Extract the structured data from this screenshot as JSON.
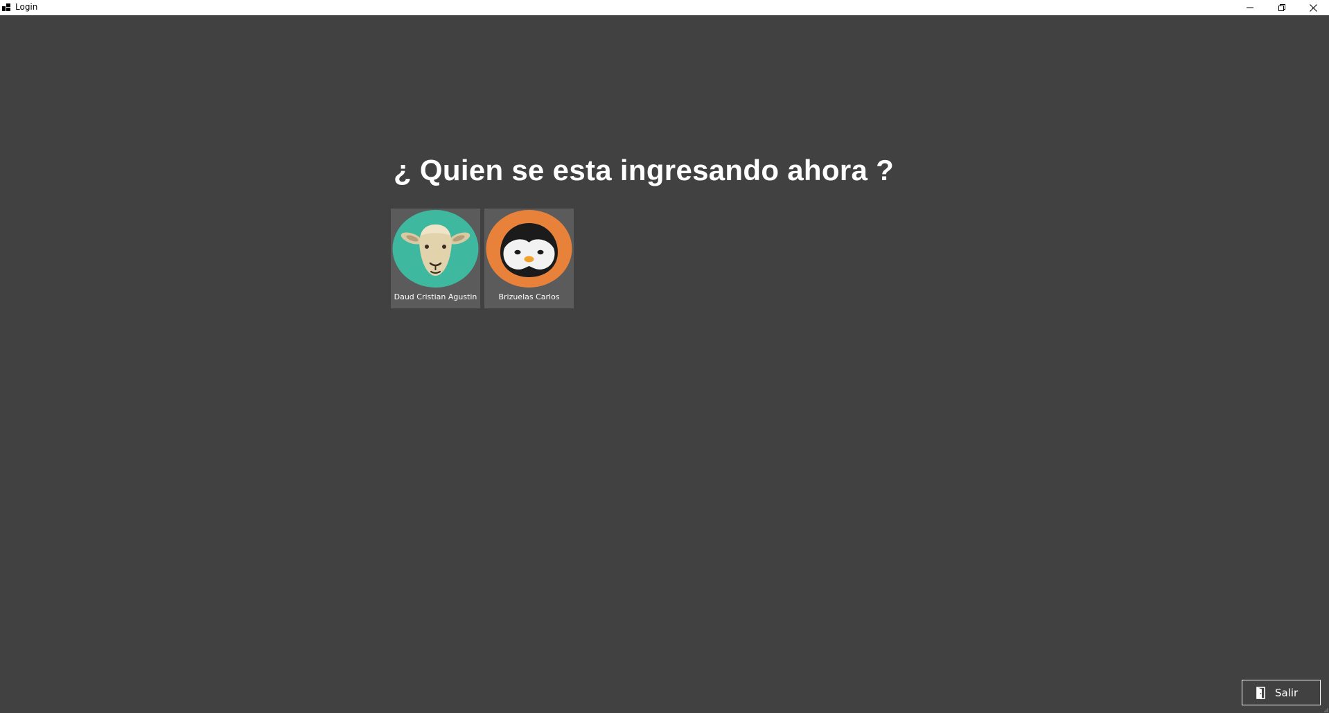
{
  "window": {
    "title": "Login",
    "icon": "app-window-icon",
    "controls": [
      "minimize-icon",
      "restore-icon",
      "close-icon"
    ]
  },
  "main": {
    "heading": "¿ Quien se esta ingresando ahora ?",
    "users": [
      {
        "name": "Daud Cristian Agustin",
        "avatar": "sheep-avatar",
        "avatar_color": "#3fb8a0"
      },
      {
        "name": "Brizuelas Carlos",
        "avatar": "penguin-avatar",
        "avatar_color": "#e8823a"
      }
    ]
  },
  "footer": {
    "exit_label": "Salir",
    "exit_icon": "door-exit-icon"
  },
  "colors": {
    "background": "#414141",
    "card": "#5b5b5b",
    "text": "#ffffff"
  }
}
